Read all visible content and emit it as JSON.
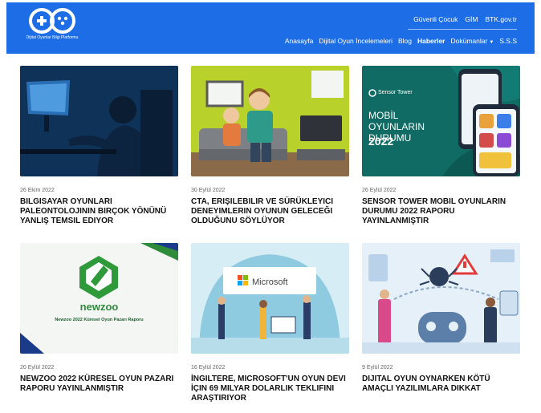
{
  "header": {
    "logo_text": "Dijital Oyunlar Bilgi Platformu",
    "utility_links": [
      "Güvenli Çocuk",
      "GİM",
      "BTK.gov.tr"
    ],
    "nav": [
      {
        "label": "Anasayfa",
        "active": false
      },
      {
        "label": "Dijital Oyun İncelemeleri",
        "active": false
      },
      {
        "label": "Blog",
        "active": false
      },
      {
        "label": "Haberler",
        "active": true
      },
      {
        "label": "Dokümanlar",
        "active": false,
        "dropdown": true
      },
      {
        "label": "S.S.S",
        "active": false
      }
    ]
  },
  "colors": {
    "brand": "#1d6ee6"
  },
  "articles": [
    {
      "date": "26 Ekim 2022",
      "title": "Bilgisayar Oyunları Paleontolojinin Birçok Yönünü Yanlış Temsil Ediyor",
      "image": "boy-at-computer"
    },
    {
      "date": "30 Eylül 2022",
      "title": "CTA, Erişilebilir ve Sürükleyici Deneyimlerin Oyunun Geleceği Olduğunu Söylüyor",
      "image": "family-gaming"
    },
    {
      "date": "26 Eylül 2022",
      "title": "Sensor Tower Mobil Oyunların Durumu 2022 Raporu Yayınlanmıştır",
      "image": "sensor-tower-report",
      "image_text": {
        "brand": "Sensor Tower",
        "heading": "MOBİL OYUNLARIN DURUMU",
        "year": "2022"
      }
    },
    {
      "date": "20 Eylül 2022",
      "title": "Newzoo 2022 Küresel Oyun Pazarı Raporu Yayınlanmıştır",
      "image": "newzoo-report",
      "image_text": {
        "brand": "newzoo",
        "caption": "Newzoo 2022 Küresel Oyun Pazarı Raporu"
      }
    },
    {
      "date": "16 Eylül 2022",
      "title": "İngiltere, Microsoft'un Oyun Devi İçin 69 Milyar Dolarlık Teklifini Araştırıyor",
      "image": "microsoft-office",
      "image_text": {
        "brand": "Microsoft"
      }
    },
    {
      "date": "9 Eylül 2022",
      "title": "Dijital Oyun Oynarken Kötü Amaçlı Yazılımlara Dikkat",
      "image": "malware-illustration"
    }
  ]
}
